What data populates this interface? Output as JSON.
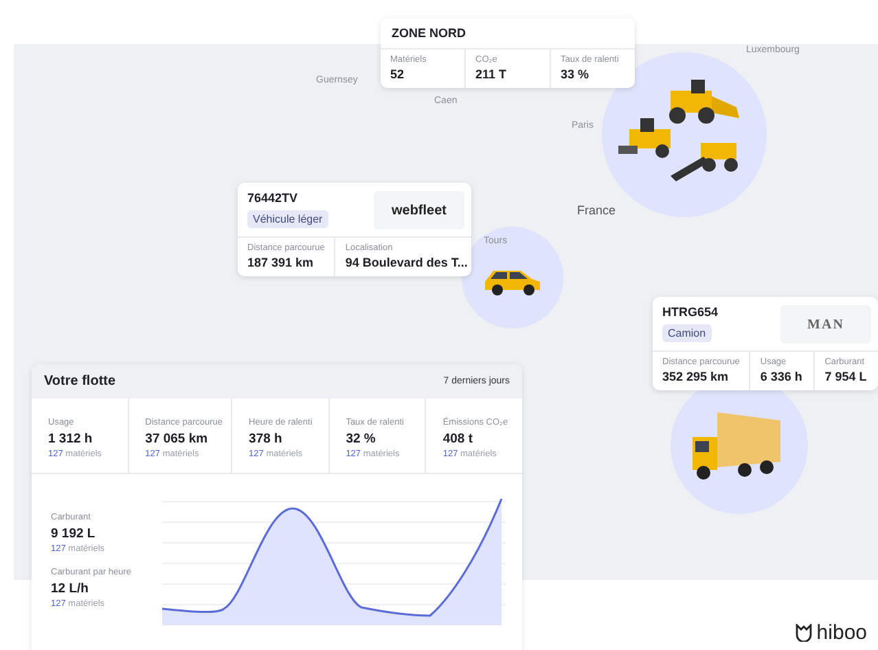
{
  "map": {
    "labels": [
      {
        "text": "Guernsey"
      },
      {
        "text": "Caen"
      },
      {
        "text": "Paris"
      },
      {
        "text": "Luxembourg"
      },
      {
        "text": "France"
      },
      {
        "text": "Tours"
      }
    ]
  },
  "zone": {
    "title": "ZONE NORD",
    "stats": [
      {
        "label": "Matériels",
        "value": "52"
      },
      {
        "label": "CO₂e",
        "value": "211 T"
      },
      {
        "label": "Taux de ralenti",
        "value": "33 %"
      }
    ]
  },
  "vehicles": [
    {
      "plate": "76442TV",
      "type": "Véhicule léger",
      "brand": "webfleet",
      "stats": [
        {
          "label": "Distance parcourue",
          "value": "187 391 km"
        },
        {
          "label": "Localisation",
          "value": "94 Boulevard des T..."
        }
      ]
    },
    {
      "plate": "HTRG654",
      "type": "Camion",
      "brand": "MAN",
      "stats": [
        {
          "label": "Distance parcourue",
          "value": "352 295 km"
        },
        {
          "label": "Usage",
          "value": "6 336 h"
        },
        {
          "label": "Carburant",
          "value": "7 954 L"
        }
      ]
    }
  ],
  "fleet": {
    "title": "Votre flotte",
    "period": "7 derniers jours",
    "kpis": [
      {
        "label": "Usage",
        "value": "1 312 h",
        "count": "127",
        "noun": "matériels"
      },
      {
        "label": "Distance parcourue",
        "value": "37 065 km",
        "count": "127",
        "noun": "matériels"
      },
      {
        "label": "Heure de ralenti",
        "value": "378 h",
        "count": "127",
        "noun": "matériels"
      },
      {
        "label": "Taux de ralenti",
        "value": "32 %",
        "count": "127",
        "noun": "matériels"
      },
      {
        "label": "Émissions CO₂e",
        "value": "408 t",
        "count": "127",
        "noun": "matériels"
      }
    ],
    "fuel": [
      {
        "label": "Carburant",
        "value": "9 192 L",
        "count": "127",
        "noun": "matériels"
      },
      {
        "label": "Carburant par heure",
        "value": "12 L/h",
        "count": "127",
        "noun": "matériels"
      }
    ]
  },
  "brand": "hiboo"
}
